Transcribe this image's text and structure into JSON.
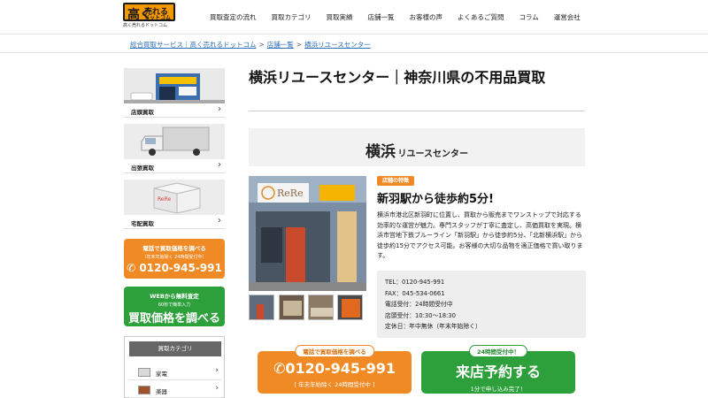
{
  "logo": {
    "main": "高く",
    "side_top": "売れる",
    "side_bottom": "ドットコム",
    "sub": "高く売れるドットコム"
  },
  "nav": [
    "買取査定の流れ",
    "買取カテゴリ",
    "買取実績",
    "店舗一覧",
    "お客様の声",
    "よくあるご質問",
    "コラム",
    "運営会社"
  ],
  "breadcrumb": [
    "総合買取サービス｜高く売れるドットコム",
    "店舗一覧",
    "横浜リユースセンター"
  ],
  "sidebar": {
    "cards": [
      {
        "label": "店頭買取",
        "arrow": "›"
      },
      {
        "label": "出張買取",
        "arrow": "›"
      },
      {
        "label": "宅配買取",
        "arrow": "›"
      }
    ],
    "phone_cta": {
      "line1": "電話で買取価格を調べる",
      "line2": "（年末年始除く 24時間受付中）",
      "line3": "0120-945-991"
    },
    "web_cta": {
      "line1": "WEBから無料査定",
      "line2": "60秒で簡単入力",
      "line3": "買取価格を調べる"
    },
    "category": {
      "header": "買取カテゴリ",
      "items": [
        {
          "label": "家電",
          "arrow": "›"
        },
        {
          "label": "楽器",
          "arrow": "›"
        }
      ]
    }
  },
  "main": {
    "title": "横浜リユースセンター｜神奈川県の不用品買取",
    "banner_big": "横浜",
    "banner_small": "リユースセンター",
    "shop_sign": "ReRe",
    "feature_badge": "店舗の特徴",
    "feature_title": "新羽駅から徒歩約5分!",
    "feature_text": "横浜市港北区新羽町に位置し、買取から販売までワンストップで対応する効率的な運営が魅力。専門スタッフが丁寧に査定し、高価買取を実現。横浜市営地下鉄ブルーライン「新羽駅」から徒歩約5分、「北新横浜駅」から徒歩約15分でアクセス可能。お客様の大切な品物を適正価格で買い取ります。",
    "info": [
      "TEL：0120-945-991",
      "FAX：045-534-0661",
      "電話受付：24時間受付中",
      "店頭受付：10:30～18:30",
      "定休日：年中無休（年末年始除く）"
    ],
    "cta_phone": {
      "tab": "電話で買取価格を調べる",
      "main": "0120-945-991",
      "sub": "[ 年末年始除く 24時間受付中 ]"
    },
    "cta_visit": {
      "tab": "24時間受付中！",
      "main": "来店予約する",
      "sub": "1分で申し込み完了！"
    }
  },
  "colors": {
    "orange": "#f08a24",
    "green": "#2ea03b",
    "link": "#2a6ebb"
  }
}
